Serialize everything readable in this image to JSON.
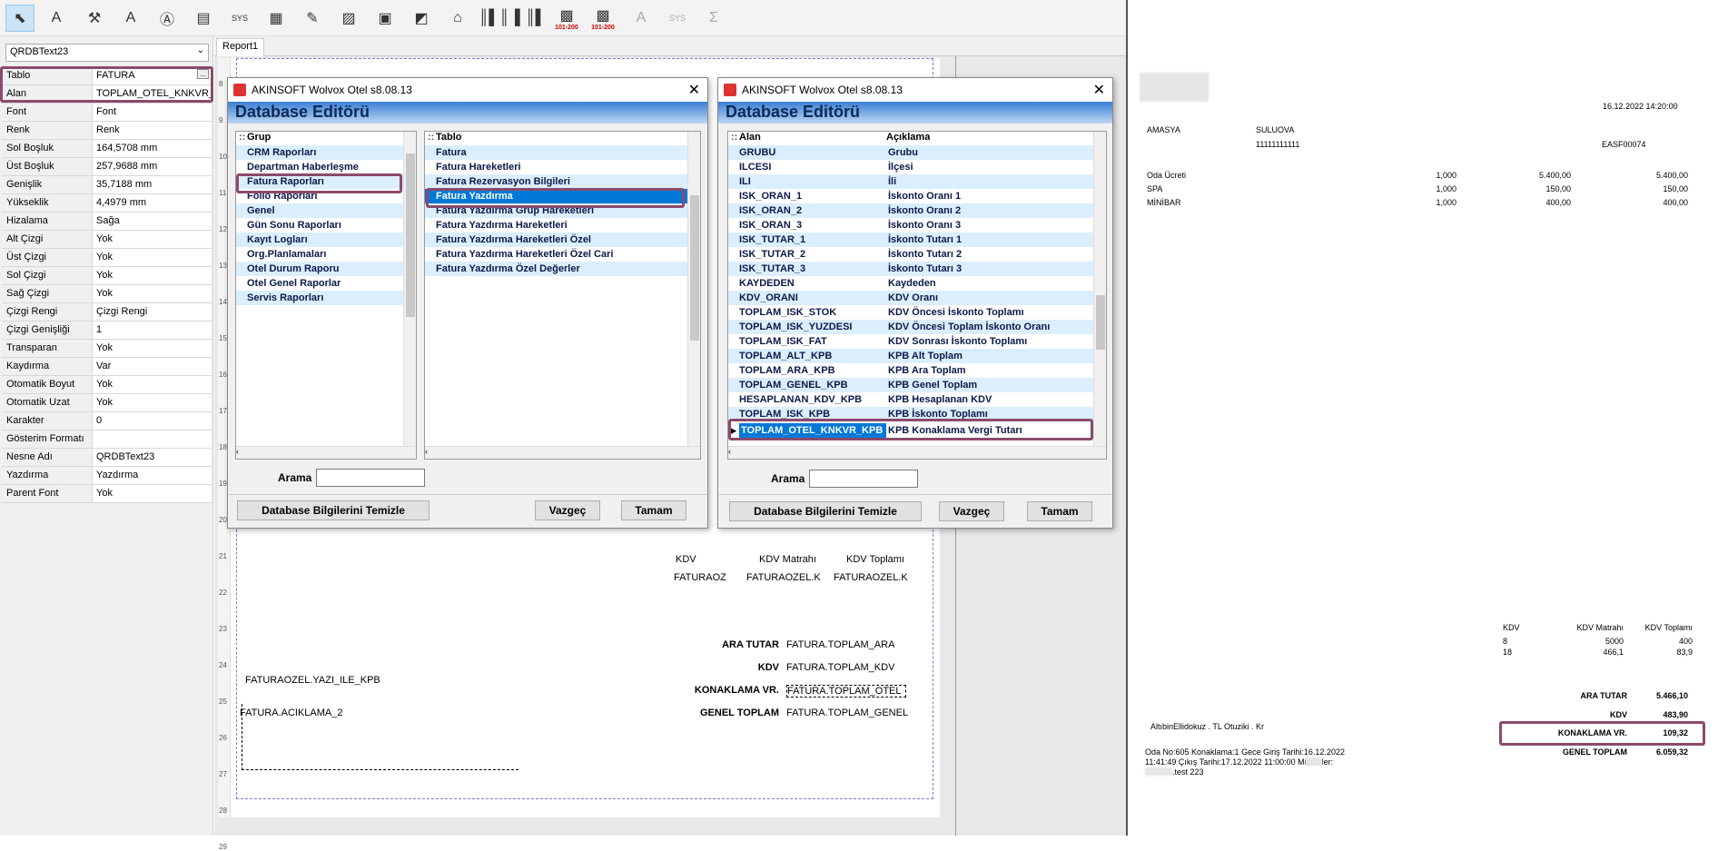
{
  "toolbar": {
    "icons": [
      "pointer-icon",
      "label-a-icon",
      "image-tool-icon",
      "text-a-icon",
      "text-field-icon",
      "system-field-icon",
      "sys-icon",
      "memo-icon",
      "richtext-icon",
      "image-icon",
      "db-image-icon",
      "chart-icon",
      "shape-icon",
      "barcode-icon",
      "barcode2-icon",
      "qr-red-icon",
      "qr-red2-icon",
      "text-disabled-icon",
      "sys-disabled-icon",
      "sum-disabled-icon"
    ],
    "sys_label": "SYS",
    "qr_label": "101-200"
  },
  "object_selector": {
    "value": "QRDBText23"
  },
  "properties": [
    {
      "key": "Tablo",
      "value": "FATURA"
    },
    {
      "key": "Alan",
      "value": "TOPLAM_OTEL_KNKVR_KPB"
    },
    {
      "key": "Font",
      "value": "Font"
    },
    {
      "key": "Renk",
      "value": "Renk"
    },
    {
      "key": "Sol Boşluk",
      "value": "164,5708 mm"
    },
    {
      "key": "Üst Boşluk",
      "value": "257,9688 mm"
    },
    {
      "key": "Genişlik",
      "value": "35,7188 mm"
    },
    {
      "key": "Yükseklik",
      "value": "4,4979 mm"
    },
    {
      "key": "Hizalama",
      "value": "Sağa"
    },
    {
      "key": "Alt Çizgi",
      "value": "Yok"
    },
    {
      "key": "Üst Çizgi",
      "value": "Yok"
    },
    {
      "key": "Sol Çizgi",
      "value": "Yok"
    },
    {
      "key": "Sağ Çizgi",
      "value": "Yok"
    },
    {
      "key": "Çizgi Rengi",
      "value": "Çizgi Rengi"
    },
    {
      "key": "Çizgi Genişliği",
      "value": "1"
    },
    {
      "key": "Transparan",
      "value": "Yok"
    },
    {
      "key": "Kaydırma",
      "value": "Var"
    },
    {
      "key": "Otomatik Boyut",
      "value": "Yok"
    },
    {
      "key": "Otomatik Uzat",
      "value": "Yok"
    },
    {
      "key": "Karakter",
      "value": "0"
    },
    {
      "key": "Gösterim Formatı",
      "value": ""
    },
    {
      "key": "Nesne Adı",
      "value": "QRDBText23"
    },
    {
      "key": "Yazdırma",
      "value": "Yazdırma"
    },
    {
      "key": "Parent Font",
      "value": "Yok"
    }
  ],
  "editor": {
    "tab": "Report1",
    "ruler": [
      "8",
      "9",
      "10",
      "11",
      "12",
      "13",
      "14",
      "15",
      "16",
      "17",
      "18",
      "19",
      "20",
      "21",
      "22",
      "23",
      "24",
      "25",
      "26",
      "27",
      "28",
      "29"
    ]
  },
  "report_fields": {
    "kdv": "KDV",
    "kdv_matrahi": "KDV Matrahı",
    "kdv_toplami": "KDV Toplamı",
    "f_kdv": "FATURAOZ",
    "f_matrah": "FATURAOZEL.K",
    "f_toplam": "FATURAOZEL.K",
    "ara_tutar": "ARA TUTAR",
    "f_ara": "FATURA.TOPLAM_ARA",
    "kdv2": "KDV",
    "f_kdv2": "FATURA.TOPLAM_KDV",
    "konaklama": "KONAKLAMA VR.",
    "f_otel": "FATURA.TOPLAM_OTEL",
    "genel": "GENEL TOPLAM",
    "f_genel": "FATURA.TOPLAM_GENEL",
    "yazi": "FATURAOZEL.YAZI_ILE_KPB",
    "aciklama": "FATURA.ACIKLAMA_2"
  },
  "dialog1": {
    "title": "AKINSOFT Wolvox Otel s8.08.13",
    "heading": "Database Editörü",
    "grup_header": "Grup",
    "tablo_header": "Tablo",
    "grup": [
      "CRM Raporları",
      "Departman Haberleşme",
      "Fatura Raporları",
      "Folio Raporları",
      "Genel",
      "Gün Sonu Raporları",
      "Kayıt Logları",
      "Org.Planlamaları",
      "Otel Durum Raporu",
      "Otel Genel Raporlar",
      "Servis Raporları"
    ],
    "tablo": [
      "Fatura",
      "Fatura Hareketleri",
      "Fatura Rezervasyon Bilgileri",
      "Fatura Yazdırma",
      "Fatura Yazdırma Grup Hareketleri",
      "Fatura Yazdırma Hareketleri",
      "Fatura Yazdırma Hareketleri Özel",
      "Fatura Yazdırma Hareketleri Özel Cari",
      "Fatura Yazdırma Özel Değerler"
    ],
    "search_label": "Arama",
    "search_value": "",
    "btn_clear": "Database Bilgilerini Temizle",
    "btn_cancel": "Vazgeç",
    "btn_ok": "Tamam"
  },
  "dialog2": {
    "title": "AKINSOFT Wolvox Otel s8.08.13",
    "heading": "Database Editörü",
    "alan_header": "Alan",
    "aciklama_header": "Açıklama",
    "rows": [
      [
        "GRUBU",
        "Grubu"
      ],
      [
        "ILCESI",
        "İlçesi"
      ],
      [
        "ILI",
        "İli"
      ],
      [
        "ISK_ORAN_1",
        "İskonto Oranı 1"
      ],
      [
        "ISK_ORAN_2",
        "İskonto Oranı 2"
      ],
      [
        "ISK_ORAN_3",
        "İskonto Oranı 3"
      ],
      [
        "ISK_TUTAR_1",
        "İskonto Tutarı 1"
      ],
      [
        "ISK_TUTAR_2",
        "İskonto Tutarı 2"
      ],
      [
        "ISK_TUTAR_3",
        "İskonto Tutarı 3"
      ],
      [
        "KAYDEDEN",
        "Kaydeden"
      ],
      [
        "KDV_ORANI",
        "KDV Oranı"
      ],
      [
        "TOPLAM_ISK_STOK",
        "KDV Öncesi İskonto Toplamı"
      ],
      [
        "TOPLAM_ISK_YUZDESI",
        "KDV Öncesi Toplam İskonto Oranı"
      ],
      [
        "TOPLAM_ISK_FAT",
        "KDV Sonrası İskonto Toplamı"
      ],
      [
        "TOPLAM_ALT_KPB",
        "KPB Alt Toplam"
      ],
      [
        "TOPLAM_ARA_KPB",
        "KPB Ara Toplam"
      ],
      [
        "TOPLAM_GENEL_KPB",
        "KPB Genel Toplam"
      ],
      [
        "HESAPLANAN_KDV_KPB",
        "KPB Hesaplanan KDV"
      ],
      [
        "TOPLAM_ISK_KPB",
        "KPB İskonto Toplamı"
      ],
      [
        "TOPLAM_OTEL_KNKVR_KPB",
        "KPB Konaklama Vergi Tutarı"
      ]
    ],
    "search_label": "Arama",
    "search_value": "",
    "btn_clear": "Database Bilgilerini Temizle",
    "btn_cancel": "Vazgeç",
    "btn_ok": "Tamam"
  },
  "invoice": {
    "datetime": "16.12.2022 14:20:00",
    "city": "AMASYA",
    "district": "SULUOVA",
    "taxno": "11111111111",
    "docno": "EASF00074",
    "items": [
      {
        "name": "Oda Ücreti",
        "qty": "1,000",
        "price": "5.400,00",
        "total": "5.400,00"
      },
      {
        "name": "SPA",
        "qty": "1,000",
        "price": "150,00",
        "total": "150,00"
      },
      {
        "name": "MİNİBAR",
        "qty": "1,000",
        "price": "400,00",
        "total": "400,00"
      }
    ],
    "kdv_header": [
      "KDV",
      "KDV Matrahı",
      "KDV Toplamı"
    ],
    "kdv_rows": [
      [
        "8",
        "5000",
        "400"
      ],
      [
        "18",
        "466,1",
        "83,9"
      ]
    ],
    "totals": [
      {
        "label": "ARA TUTAR",
        "value": "5.466,10"
      },
      {
        "label": "KDV",
        "value": "483,90"
      },
      {
        "label": "KONAKLAMA VR.",
        "value": "109,32"
      },
      {
        "label": "GENEL TOPLAM",
        "value": "6.059,32"
      }
    ],
    "words": "AltıbinEllidokuz . TL Otuziki . Kr",
    "note1": "Oda No:605 Konaklama:1 Gece Giriş Tarihi:16.12.2022",
    "note2": "11:41:49 Çıkış Tarihi:17.12.2022 11:00:00 Misafirler:",
    "note3": ".test 223"
  }
}
